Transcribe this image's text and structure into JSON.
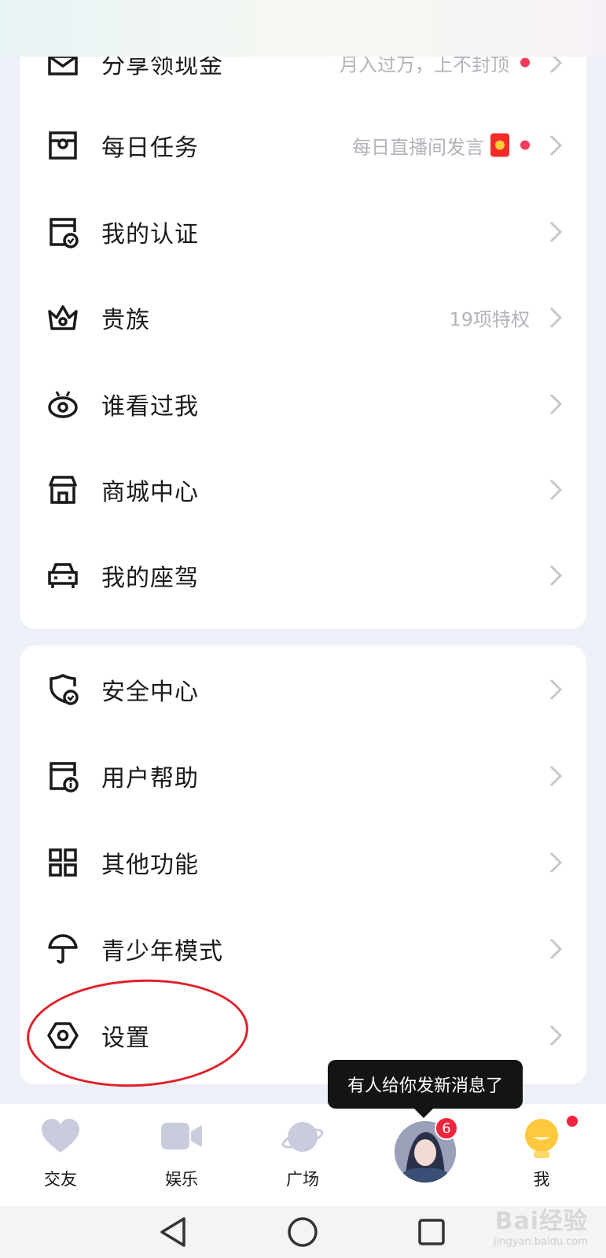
{
  "menu_group_1": [
    {
      "label": "分享领现金",
      "right_text": "月入过万，上不封顶",
      "has_dot": true,
      "icon": "envelope-icon"
    },
    {
      "label": "每日任务",
      "right_text": "每日直播间发言",
      "has_redpacket": true,
      "has_dot": true,
      "icon": "task-icon"
    },
    {
      "label": "我的认证",
      "right_text": "",
      "icon": "certificate-icon"
    },
    {
      "label": "贵族",
      "right_text": "19项特权",
      "icon": "crown-icon"
    },
    {
      "label": "谁看过我",
      "right_text": "",
      "icon": "eye-icon"
    },
    {
      "label": "商城中心",
      "right_text": "",
      "icon": "store-icon"
    },
    {
      "label": "我的座驾",
      "right_text": "",
      "icon": "car-icon"
    }
  ],
  "menu_group_2": [
    {
      "label": "安全中心",
      "icon": "shield-icon"
    },
    {
      "label": "用户帮助",
      "icon": "help-icon"
    },
    {
      "label": "其他功能",
      "icon": "grid-icon"
    },
    {
      "label": "青少年模式",
      "icon": "umbrella-icon"
    },
    {
      "label": "设置",
      "icon": "settings-hexagon-icon"
    }
  ],
  "tooltip": "有人给你发新消息了",
  "tabs": [
    {
      "label": "交友",
      "icon": "heart-icon"
    },
    {
      "label": "娱乐",
      "icon": "video-camera-icon"
    },
    {
      "label": "广场",
      "icon": "planet-icon"
    },
    {
      "label": "",
      "icon": "avatar-image",
      "badge": "6"
    },
    {
      "label": "我",
      "icon": "me-icon"
    }
  ],
  "watermark": {
    "main": "Bai经验",
    "sub": "jingyan.baidu.com"
  },
  "colors": {
    "accent_red": "#f23c5a",
    "annotation_red": "#e0202a",
    "tab_icon_gray": "#c9ccdc",
    "me_icon_yellow": "#ffc83d"
  }
}
